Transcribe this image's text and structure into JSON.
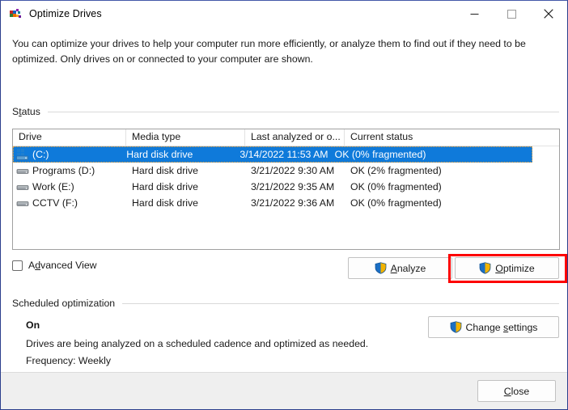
{
  "window": {
    "title": "Optimize Drives",
    "icon": "defrag-icon",
    "controls": {
      "minimize": "minimize-icon",
      "maximize": "maximize-icon",
      "close": "close-icon"
    }
  },
  "intro": {
    "line1": "You can optimize your drives to help your computer run more efficiently, or analyze them to find out if they need to be",
    "line2": "optimized. Only drives on or connected to your computer are shown."
  },
  "status_group": {
    "label_pre": "S",
    "label_accel": "t",
    "label_post": "atus",
    "columns": [
      "Drive",
      "Media type",
      "Last analyzed or o...",
      "Current status"
    ],
    "rows": [
      {
        "icon": "system-drive-icon",
        "drive": "(C:)",
        "media": "Hard disk drive",
        "last": "3/14/2022 11:53 AM",
        "status": "OK (0% fragmented)",
        "selected": true
      },
      {
        "icon": "hard-drive-icon",
        "drive": "Programs (D:)",
        "media": "Hard disk drive",
        "last": "3/21/2022 9:30 AM",
        "status": "OK (2% fragmented)",
        "selected": false
      },
      {
        "icon": "hard-drive-icon",
        "drive": "Work (E:)",
        "media": "Hard disk drive",
        "last": "3/21/2022 9:35 AM",
        "status": "OK (0% fragmented)",
        "selected": false
      },
      {
        "icon": "hard-drive-icon",
        "drive": "CCTV (F:)",
        "media": "Hard disk drive",
        "last": "3/21/2022 9:36 AM",
        "status": "OK (0% fragmented)",
        "selected": false
      }
    ]
  },
  "advanced_view": {
    "label_pre": "A",
    "label_accel": "d",
    "label_post": "vanced View",
    "checked": false
  },
  "buttons": {
    "analyze": {
      "pre": "",
      "accel": "A",
      "post": "nalyze",
      "icon": "uac-shield-icon"
    },
    "optimize": {
      "pre": "",
      "accel": "O",
      "post": "ptimize",
      "icon": "uac-shield-icon",
      "highlighted": true
    },
    "change_settings": {
      "pre": "Change ",
      "accel": "s",
      "post": "ettings",
      "icon": "uac-shield-icon"
    },
    "close": {
      "pre": "",
      "accel": "C",
      "post": "lose"
    }
  },
  "scheduled_group": {
    "label": "Scheduled optimization",
    "state": "On",
    "description": "Drives are being analyzed on a scheduled cadence and optimized as needed.",
    "frequency": "Frequency: Weekly"
  },
  "colors": {
    "selection_blue": "#0f7ada",
    "highlight_red": "#fd0000",
    "window_border": "#2b3f8c",
    "footer_bg": "#efefef"
  }
}
